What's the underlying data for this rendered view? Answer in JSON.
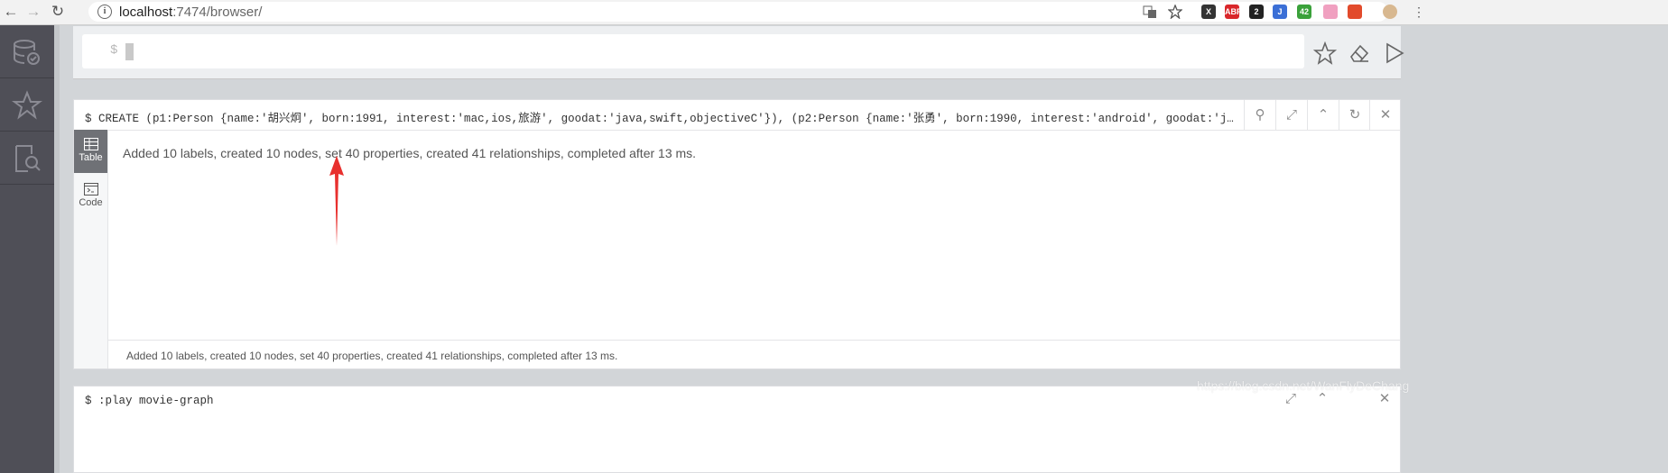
{
  "browser": {
    "url_host": "localhost",
    "url_port_path": ":7474/browser/",
    "extensions": [
      {
        "name": "x-extension",
        "label": "X",
        "color": "#333333"
      },
      {
        "name": "abp-extension",
        "label": "ABP",
        "color": "#d9262a"
      },
      {
        "name": "badge-extension",
        "label": "2",
        "color": "#222222"
      },
      {
        "name": "blue-extension",
        "label": "J",
        "color": "#3b6fd6"
      },
      {
        "name": "wechat-extension",
        "label": "42",
        "color": "#3aa13a"
      },
      {
        "name": "pink-extension",
        "label": "",
        "color": "#f0a0c0"
      },
      {
        "name": "weibo-extension",
        "label": "",
        "color": "#e24a2b"
      }
    ]
  },
  "editor": {
    "prompt": "$"
  },
  "frame": {
    "command": "$ CREATE  (p1:Person {name:'胡兴炯', born:1991, interest:'mac,ios,旅游', goodat:'java,swift,objectiveC'}), (p2:Person {name:'张勇', born:1990, interest:'android', goodat:'java,android'}), (p3:…",
    "tabs": [
      {
        "label": "Table",
        "active": true
      },
      {
        "label": "Code",
        "active": false
      }
    ],
    "result_message": "Added 10 labels, created 10 nodes, set 40 properties, created 41 relationships, completed after 13 ms.",
    "status_message": "Added 10 labels, created 10 nodes, set 40 properties, created 41 relationships, completed after 13 ms."
  },
  "frame2": {
    "command": "$ :play movie-graph"
  },
  "watermark": "https://blog.csdn.net/WanFlyDeChang",
  "colors": {
    "sidebar": "#4f4f57",
    "arrow": "#e8302e",
    "active_tab": "#6f7176"
  }
}
